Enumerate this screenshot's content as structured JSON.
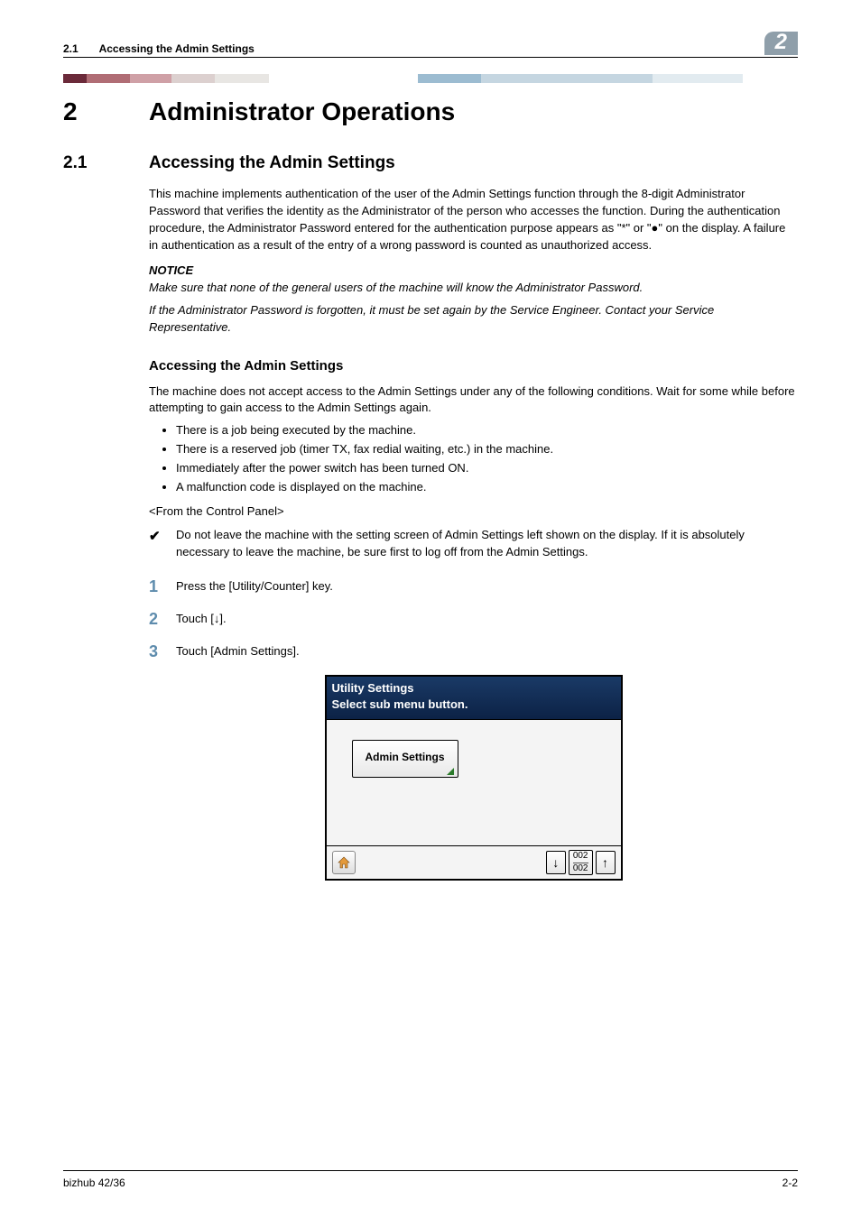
{
  "header": {
    "section_number": "2.1",
    "section_title": "Accessing the Admin Settings",
    "chapter_tab": "2"
  },
  "chapter": {
    "number": "2",
    "title": "Administrator Operations"
  },
  "section": {
    "number": "2.1",
    "title": "Accessing the Admin Settings",
    "intro": "This machine implements authentication of the user of the Admin Settings function through the 8-digit Administrator Password that verifies the identity as the Administrator of the person who accesses the function. During the authentication procedure, the Administrator Password entered for the authentication purpose appears as \"*\" or \"●\" on the display. A failure in authentication as a result of the entry of a wrong password is counted as unauthorized access.",
    "notice_label": "NOTICE",
    "notice_line1": "Make sure that none of the general users of the machine will know the Administrator Password.",
    "notice_line2": "If the Administrator Password is forgotten, it must be set again by the Service Engineer. Contact your Service Representative."
  },
  "subsection": {
    "title": "Accessing the Admin Settings",
    "intro": "The machine does not accept access to the Admin Settings under any of the following conditions. Wait for some while before attempting to gain access to the Admin Settings again.",
    "bullets": [
      "There is a job being executed by the machine.",
      "There is a reserved job (timer TX, fax redial waiting, etc.) in the machine.",
      "Immediately after the power switch has been turned ON.",
      "A malfunction code is displayed on the machine."
    ],
    "angle_label": "<From the Control Panel>",
    "check_note": "Do not leave the machine with the setting screen of Admin Settings left shown on the display. If it is absolutely necessary to leave the machine, be sure first to log off from the Admin Settings.",
    "steps": [
      "Press the [Utility/Counter] key.",
      "Touch [↓].",
      "Touch [Admin Settings]."
    ]
  },
  "device_screen": {
    "title_line1": "Utility Settings",
    "title_line2": "Select sub menu button.",
    "button_label": "Admin Settings",
    "page_current": "002",
    "page_total": "002"
  },
  "footer": {
    "model": "bizhub 42/36",
    "page": "2-2"
  }
}
